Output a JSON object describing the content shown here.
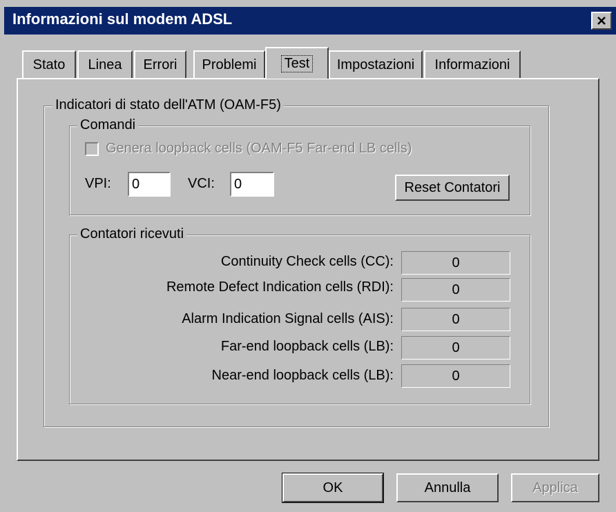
{
  "window": {
    "title": "Informazioni sul modem ADSL",
    "close_symbol": "✕",
    "title_bar_color": "#0a246a"
  },
  "tabs": [
    {
      "label": "Stato"
    },
    {
      "label": "Linea"
    },
    {
      "label": "Errori"
    },
    {
      "label": "Problemi"
    },
    {
      "label": "Test",
      "active": true
    },
    {
      "label": "Impostazioni"
    },
    {
      "label": "Informazioni"
    }
  ],
  "atm_group": {
    "label": "Indicatori di stato dell'ATM (OAM-F5)"
  },
  "commands": {
    "label": "Comandi",
    "loopback_checkbox_label": "Genera loopback cells (OAM-F5 Far-end LB cells)",
    "loopback_checked": false,
    "vpi_label": "VPI:",
    "vpi_value": "0",
    "vci_label": "VCI:",
    "vci_value": "0",
    "reset_button": "Reset Contatori"
  },
  "counters": {
    "label": "Contatori ricevuti",
    "rows": [
      {
        "label": "Continuity Check cells (CC):",
        "value": "0"
      },
      {
        "label": "Remote Defect Indication cells (RDI):",
        "value": "0"
      },
      {
        "label": "Alarm Indication Signal cells (AIS):",
        "value": "0"
      },
      {
        "label": "Far-end loopback cells (LB):",
        "value": "0"
      },
      {
        "label": "Near-end loopback cells (LB):",
        "value": "0"
      }
    ]
  },
  "buttons": {
    "ok": "OK",
    "cancel": "Annulla",
    "apply": "Applica"
  }
}
